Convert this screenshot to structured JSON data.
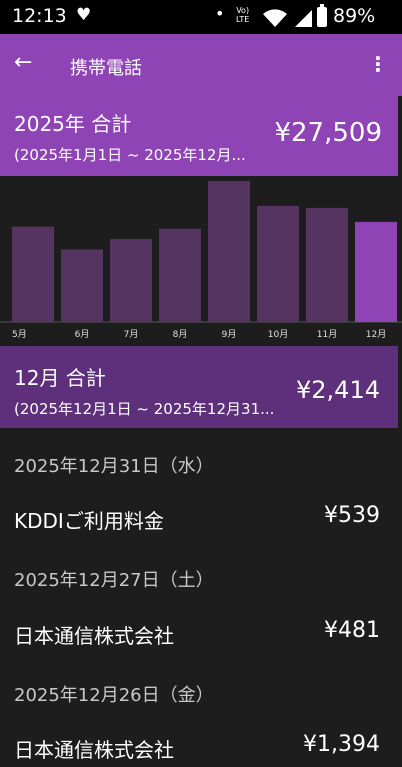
{
  "status": {
    "time": "12:13",
    "battery": "89%",
    "volte_top": "Vo)",
    "volte_bottom": "LTE"
  },
  "appbar": {
    "title": "携帯電話"
  },
  "year_summary": {
    "label": "2025年 合計",
    "range": "(2025年1月1日 ~ 2025年12月...",
    "amount": "¥27,509"
  },
  "chart_data": {
    "type": "bar",
    "categories": [
      "5月",
      "6月",
      "7月",
      "8月",
      "9月",
      "10月",
      "11月",
      "12月"
    ],
    "values": [
      2300,
      1750,
      2000,
      2250,
      3400,
      2800,
      2750,
      2414
    ],
    "highlight_index": 7,
    "colors": {
      "bar": "#563461",
      "highlight": "#8e44b5"
    }
  },
  "month_summary": {
    "label": "12月 合計",
    "range": "(2025年12月1日 ~ 2025年12月31...",
    "amount": "¥2,414"
  },
  "transactions": [
    {
      "date": "2025年12月31日（水）",
      "name": "KDDIご利用料金",
      "amount": "¥539"
    },
    {
      "date": "2025年12月27日（土）",
      "name": "日本通信株式会社",
      "amount": "¥481"
    },
    {
      "date": "2025年12月26日（金）",
      "name": "日本通信株式会社",
      "amount": "¥1,394"
    }
  ]
}
